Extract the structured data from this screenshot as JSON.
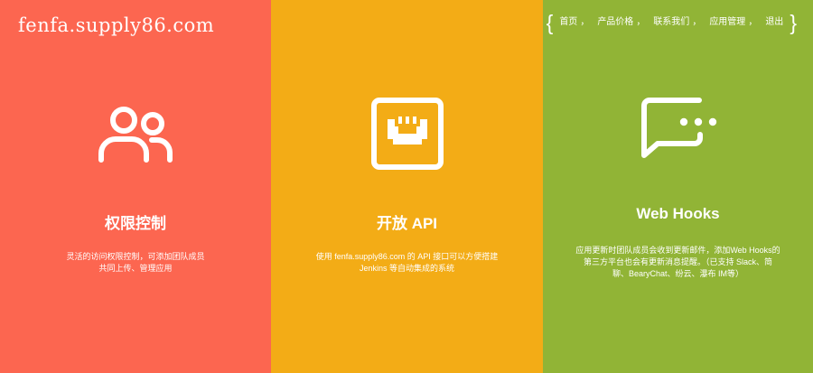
{
  "logo": "fenfa.supply86.com",
  "nav": {
    "brace_open": "{",
    "brace_close": "}",
    "separator": "，",
    "items": [
      "首页",
      "产品价格",
      "联系我们",
      "应用管理",
      "退出"
    ]
  },
  "colors": {
    "panel_red": "#FC6650",
    "panel_orange": "#F3AC16",
    "panel_green": "#91B436"
  },
  "features": [
    {
      "icon": "users-icon",
      "title": "权限控制",
      "desc_lines": [
        "灵活的访问权限控制，可添加团队成员",
        "共同上传、管理应用"
      ]
    },
    {
      "icon": "ethernet-port-icon",
      "title": "开放 API",
      "desc_lines": [
        "使用 fenfa.supply86.com 的 API 接口可以方便搭建",
        "Jenkins 等自动集成的系统"
      ]
    },
    {
      "icon": "chat-bubble-icon",
      "title": "Web Hooks",
      "desc_lines": [
        "应用更新时团队成员会收到更新邮件，添加Web Hooks的",
        "第三方平台也会有更新消息提醒。（已支持 Slack、简",
        "聊、BearyChat、纷云、瀑布 IM等）"
      ]
    }
  ]
}
